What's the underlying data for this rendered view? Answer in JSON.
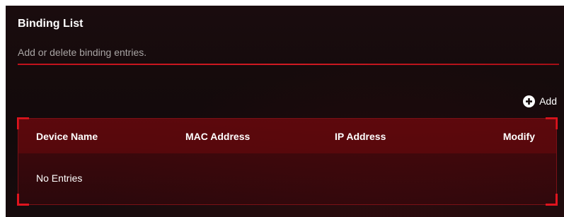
{
  "panel": {
    "title": "Binding List",
    "subtitle": "Add or delete binding entries."
  },
  "toolbar": {
    "add_label": "Add",
    "add_icon": "plus-circle-icon"
  },
  "table": {
    "columns": [
      "Device Name",
      "MAC Address",
      "IP Address",
      "Modify"
    ],
    "empty_text": "No Entries"
  },
  "colors": {
    "accent": "#d01a22",
    "panel_bg": "#140a0b",
    "subtitle_text": "#a8a4a4"
  }
}
